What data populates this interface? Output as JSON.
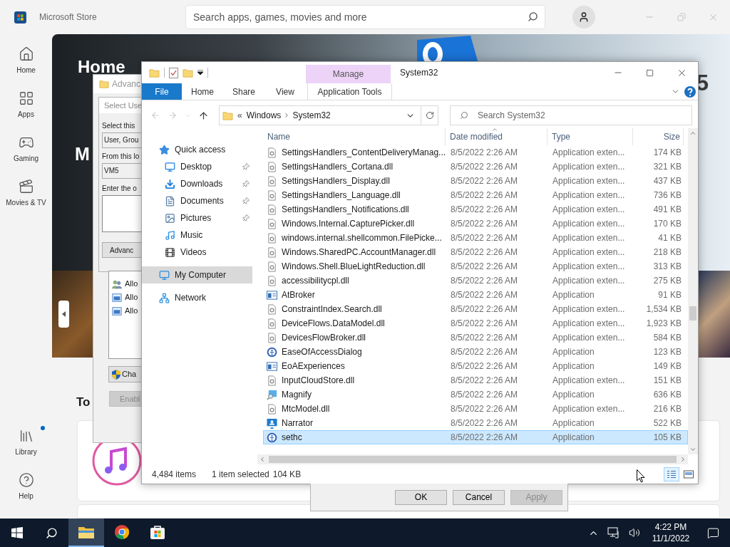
{
  "store": {
    "title": "Microsoft Store",
    "search_placeholder": "Search apps, games, movies and more",
    "nav": [
      {
        "label": "Home",
        "kind": "home"
      },
      {
        "label": "Apps",
        "kind": "apps"
      },
      {
        "label": "Gaming",
        "kind": "gaming"
      },
      {
        "label": "Movies & TV",
        "kind": "movies"
      }
    ],
    "bottom_nav": [
      {
        "label": "Library",
        "kind": "library",
        "badge": true
      },
      {
        "label": "Help",
        "kind": "help",
        "badge": false
      }
    ],
    "hero": {
      "title": "Home",
      "fragment": "M",
      "side_fragment": "5"
    },
    "section_title": "To"
  },
  "security_dialog": {
    "title": "Advanc",
    "select_dialog": {
      "title": "Select Use",
      "object_type_label": "Select this",
      "object_type_value": "User, Grou",
      "location_label": "From this lo",
      "location_value": "VM5",
      "names_label": "Enter the o",
      "advanced_button": "Advanc"
    },
    "entries": [
      {
        "label": "Allo",
        "kind": "users"
      },
      {
        "label": "Allo",
        "kind": "app"
      },
      {
        "label": "Allo",
        "kind": "app"
      }
    ],
    "change_button": "Cha",
    "enable_button": {
      "label": "Enabl",
      "disabled": true
    }
  },
  "explorer": {
    "title": "System32",
    "context_group": "Manage",
    "tabs": [
      {
        "label": "File",
        "kind": "file"
      },
      {
        "label": "Home",
        "kind": "plain"
      },
      {
        "label": "Share",
        "kind": "plain"
      },
      {
        "label": "View",
        "kind": "plain"
      },
      {
        "label": "Application Tools",
        "kind": "context"
      }
    ],
    "address": {
      "prefix": "«",
      "crumbs": [
        "Windows",
        "System32"
      ]
    },
    "search_placeholder": "Search System32",
    "nav_pane": [
      {
        "label": "Quick access",
        "kind": "star",
        "selected": false,
        "children": [
          {
            "label": "Desktop",
            "kind": "desktop",
            "pinned": true,
            "selected": false
          },
          {
            "label": "Downloads",
            "kind": "downloads",
            "pinned": true,
            "selected": false
          },
          {
            "label": "Documents",
            "kind": "documents",
            "pinned": true,
            "selected": false
          },
          {
            "label": "Pictures",
            "kind": "pictures",
            "pinned": true,
            "selected": false
          },
          {
            "label": "Music",
            "kind": "music",
            "pinned": false,
            "selected": false
          },
          {
            "label": "Videos",
            "kind": "videos",
            "pinned": false,
            "selected": false
          }
        ]
      },
      {
        "label": "My Computer",
        "kind": "computer",
        "selected": true
      },
      {
        "label": "Network",
        "kind": "network",
        "selected": false
      }
    ],
    "columns": [
      {
        "label": "Name",
        "sorted": false
      },
      {
        "label": "Date modified",
        "sorted": true
      },
      {
        "label": "Type",
        "sorted": false
      },
      {
        "label": "Size",
        "sorted": false
      }
    ],
    "rows": [
      {
        "name": "SettingsHandlers_ContentDeliveryManag...",
        "date": "8/5/2022 2:26 AM",
        "type": "Application exten...",
        "size": "174 KB",
        "kind": "dll",
        "selected": false
      },
      {
        "name": "SettingsHandlers_Cortana.dll",
        "date": "8/5/2022 2:26 AM",
        "type": "Application exten...",
        "size": "321 KB",
        "kind": "dll",
        "selected": false
      },
      {
        "name": "SettingsHandlers_Display.dll",
        "date": "8/5/2022 2:26 AM",
        "type": "Application exten...",
        "size": "437 KB",
        "kind": "dll",
        "selected": false
      },
      {
        "name": "SettingsHandlers_Language.dll",
        "date": "8/5/2022 2:26 AM",
        "type": "Application exten...",
        "size": "736 KB",
        "kind": "dll",
        "selected": false
      },
      {
        "name": "SettingsHandlers_Notifications.dll",
        "date": "8/5/2022 2:26 AM",
        "type": "Application exten...",
        "size": "491 KB",
        "kind": "dll",
        "selected": false
      },
      {
        "name": "Windows.Internal.CapturePicker.dll",
        "date": "8/5/2022 2:26 AM",
        "type": "Application exten...",
        "size": "170 KB",
        "kind": "dll",
        "selected": false
      },
      {
        "name": "windows.internal.shellcommon.FilePicke...",
        "date": "8/5/2022 2:26 AM",
        "type": "Application exten...",
        "size": "41 KB",
        "kind": "dll",
        "selected": false
      },
      {
        "name": "Windows.SharedPC.AccountManager.dll",
        "date": "8/5/2022 2:26 AM",
        "type": "Application exten...",
        "size": "218 KB",
        "kind": "dll",
        "selected": false
      },
      {
        "name": "Windows.Shell.BlueLightReduction.dll",
        "date": "8/5/2022 2:26 AM",
        "type": "Application exten...",
        "size": "313 KB",
        "kind": "dll",
        "selected": false
      },
      {
        "name": "accessibilitycpl.dll",
        "date": "8/5/2022 2:26 AM",
        "type": "Application exten...",
        "size": "275 KB",
        "kind": "dll",
        "selected": false
      },
      {
        "name": "AtBroker",
        "date": "8/5/2022 2:26 AM",
        "type": "Application",
        "size": "91 KB",
        "kind": "app",
        "selected": false
      },
      {
        "name": "ConstraintIndex.Search.dll",
        "date": "8/5/2022 2:26 AM",
        "type": "Application exten...",
        "size": "1,534 KB",
        "kind": "dll",
        "selected": false
      },
      {
        "name": "DeviceFlows.DataModel.dll",
        "date": "8/5/2022 2:26 AM",
        "type": "Application exten...",
        "size": "1,923 KB",
        "kind": "dll",
        "selected": false
      },
      {
        "name": "DevicesFlowBroker.dll",
        "date": "8/5/2022 2:26 AM",
        "type": "Application exten...",
        "size": "584 KB",
        "kind": "dll",
        "selected": false
      },
      {
        "name": "EaseOfAccessDialog",
        "date": "8/5/2022 2:26 AM",
        "type": "Application",
        "size": "123 KB",
        "kind": "ease",
        "selected": false
      },
      {
        "name": "EoAExperiences",
        "date": "8/5/2022 2:26 AM",
        "type": "Application",
        "size": "149 KB",
        "kind": "app",
        "selected": false
      },
      {
        "name": "InputCloudStore.dll",
        "date": "8/5/2022 2:26 AM",
        "type": "Application exten...",
        "size": "151 KB",
        "kind": "dll",
        "selected": false
      },
      {
        "name": "Magnify",
        "date": "8/5/2022 2:26 AM",
        "type": "Application",
        "size": "636 KB",
        "kind": "magnify",
        "selected": false
      },
      {
        "name": "MtcModel.dll",
        "date": "8/5/2022 2:26 AM",
        "type": "Application exten...",
        "size": "216 KB",
        "kind": "dll",
        "selected": false
      },
      {
        "name": "Narrator",
        "date": "8/5/2022 2:26 AM",
        "type": "Application",
        "size": "522 KB",
        "kind": "narrator",
        "selected": false
      },
      {
        "name": "sethc",
        "date": "8/5/2022 2:26 AM",
        "type": "Application",
        "size": "105 KB",
        "kind": "ease",
        "selected": true
      }
    ],
    "status": {
      "item_count": "4,484 items",
      "selection": "1 item selected",
      "size": "104 KB",
      "views": [
        {
          "kind": "details",
          "selected": true
        },
        {
          "kind": "thumbnails",
          "selected": false
        }
      ]
    }
  },
  "dialog_buttons": [
    {
      "label": "OK",
      "disabled": false
    },
    {
      "label": "Cancel",
      "disabled": false
    },
    {
      "label": "Apply",
      "disabled": true
    }
  ],
  "taskbar": {
    "apps": [
      {
        "kind": "explorer",
        "active": true
      },
      {
        "kind": "chrome",
        "active": false
      },
      {
        "kind": "store",
        "active": false
      }
    ],
    "time": "4:22 PM",
    "date": "11/1/2022"
  }
}
